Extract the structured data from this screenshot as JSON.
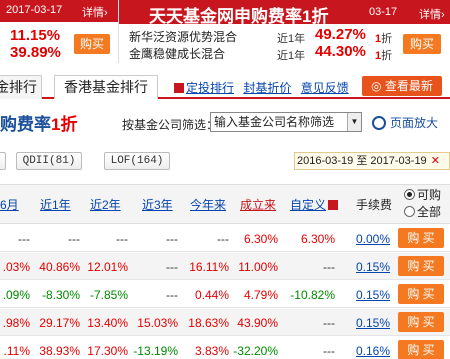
{
  "banner_left": {
    "date": "2017-03-17",
    "detail": "详情›",
    "rate1": "11.15%",
    "rate2": "39.89%",
    "buy": "购买"
  },
  "banner_right": {
    "title": "天天基金网申购费率1折",
    "date": "03-17",
    "detail": "详情›",
    "funds": [
      {
        "name": "新华泛资源优势混合",
        "period": "近1年",
        "pct": "49.27%",
        "disc_num": "1",
        "disc_unit": "折"
      },
      {
        "name": "金鹰稳健成长混合",
        "period": "近1年",
        "pct": "44.30%",
        "disc_num": "1",
        "disc_unit": "折"
      }
    ],
    "buy": "购买"
  },
  "tabs": {
    "tab1": "金排行",
    "tab2": "香港基金排行",
    "links": [
      "定投排行",
      "封基折价",
      "意见反馈"
    ],
    "latest": "查看最新"
  },
  "filter": {
    "heading_pre": "购费率",
    "heading_num": "1折",
    "company_label": "按基金公司筛选：",
    "company_select": "输入基金公司名称筛选",
    "zoom": "页面放大",
    "qdii": "QDII(81)",
    "lof": "LOF(164)",
    "date_from": "2016-03-19",
    "date_to_label": "至",
    "date_to": "2017-03-19",
    "close": "✕"
  },
  "table": {
    "headers": [
      "6月",
      "近1年",
      "近2年",
      "近3年",
      "今年来",
      "成立来",
      "自定义",
      "手续费"
    ],
    "radio_buyable": "可购",
    "radio_all": "全部",
    "buy_label": "购 买",
    "rows": [
      {
        "c": [
          "---",
          "---",
          "---",
          "---",
          "---",
          "6.30%",
          "6.30%"
        ],
        "s": [
          "nil",
          "nil",
          "nil",
          "nil",
          "nil",
          "pos",
          "pos"
        ],
        "fee": "0.00%"
      },
      {
        "c": [
          ".03%",
          "40.86%",
          "12.01%",
          "---",
          "16.11%",
          "11.00%",
          "---"
        ],
        "s": [
          "pos",
          "pos",
          "pos",
          "nil",
          "pos",
          "pos",
          "nil"
        ],
        "fee": "0.15%"
      },
      {
        "c": [
          ".09%",
          "-8.30%",
          "-7.85%",
          "---",
          "0.44%",
          "4.79%",
          "-10.82%"
        ],
        "s": [
          "neg",
          "neg",
          "neg",
          "nil",
          "pos",
          "pos",
          "neg"
        ],
        "fee": "0.15%"
      },
      {
        "c": [
          ".98%",
          "29.17%",
          "13.40%",
          "15.03%",
          "18.63%",
          "43.90%",
          "---"
        ],
        "s": [
          "pos",
          "pos",
          "pos",
          "pos",
          "pos",
          "pos",
          "nil"
        ],
        "fee": "0.15%"
      },
      {
        "c": [
          ".11%",
          "38.93%",
          "17.30%",
          "-13.19%",
          "3.83%",
          "-32.20%",
          "---"
        ],
        "s": [
          "pos",
          "pos",
          "pos",
          "neg",
          "pos",
          "neg",
          "nil"
        ],
        "fee": "0.16%"
      }
    ]
  },
  "colors": {
    "brand_red": "#c8161e",
    "buy_orange": "#f47920",
    "link_blue": "#0645ad",
    "positive": "#e40000",
    "negative": "#008a00"
  }
}
